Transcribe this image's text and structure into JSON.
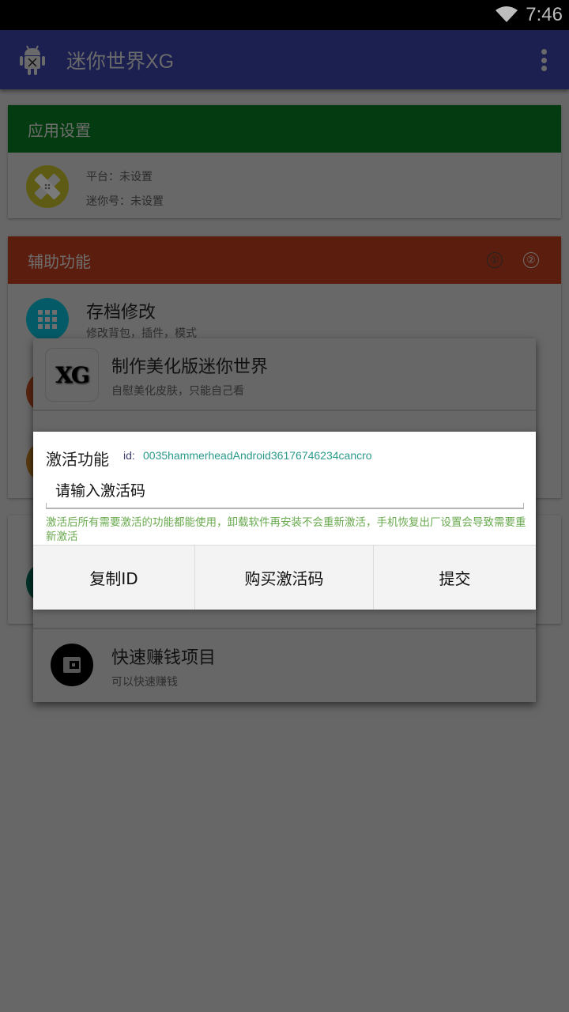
{
  "status_bar": {
    "time": "7:46",
    "wifi_icon": "wifi-icon"
  },
  "app_bar": {
    "title": "迷你世界XG",
    "app_icon": "android-icon",
    "menu_icon": "overflow-menu-icon"
  },
  "colors": {
    "app_bar": "#1b2050",
    "settings_header": "#053b10",
    "features_header": "#5b1e0e",
    "hint_text": "#6aaa4f",
    "id_value": "#2a9a8a",
    "scrim_background": "#676767"
  },
  "settings_card": {
    "header": "应用设置",
    "icon": "bandage-icon",
    "platform_line": "平台：未设置",
    "mini_id_line": "迷你号：未设置"
  },
  "features_card": {
    "header": "辅助功能",
    "badge_1": "①",
    "badge_2": "②",
    "items": [
      {
        "title": "存档修改",
        "subtitle": "修改背包，插件，模式",
        "icon": "grid-apps-icon"
      }
    ]
  },
  "popup_menu": {
    "items": [
      {
        "title": "制作美化版迷你世界",
        "subtitle": "自慰美化皮肤，只能自己看",
        "icon_text": "XG"
      },
      {
        "title": "快速赚钱项目",
        "subtitle": "可以快速赚钱",
        "icon": "wallet-icon"
      }
    ]
  },
  "dialog": {
    "title": "激活功能",
    "id_label": "id:",
    "id_value": "0035hammerheadAndroid36176746234cancro",
    "input_placeholder": "请输入激活码",
    "input_value": "",
    "hint": "激活后所有需要激活的功能都能使用，卸载软件再安装不会重新激活，手机恢复出厂设置会导致需要重新激活",
    "buttons": {
      "copy_id": "复制ID",
      "buy_code": "购买激活码",
      "submit": "提交"
    }
  }
}
